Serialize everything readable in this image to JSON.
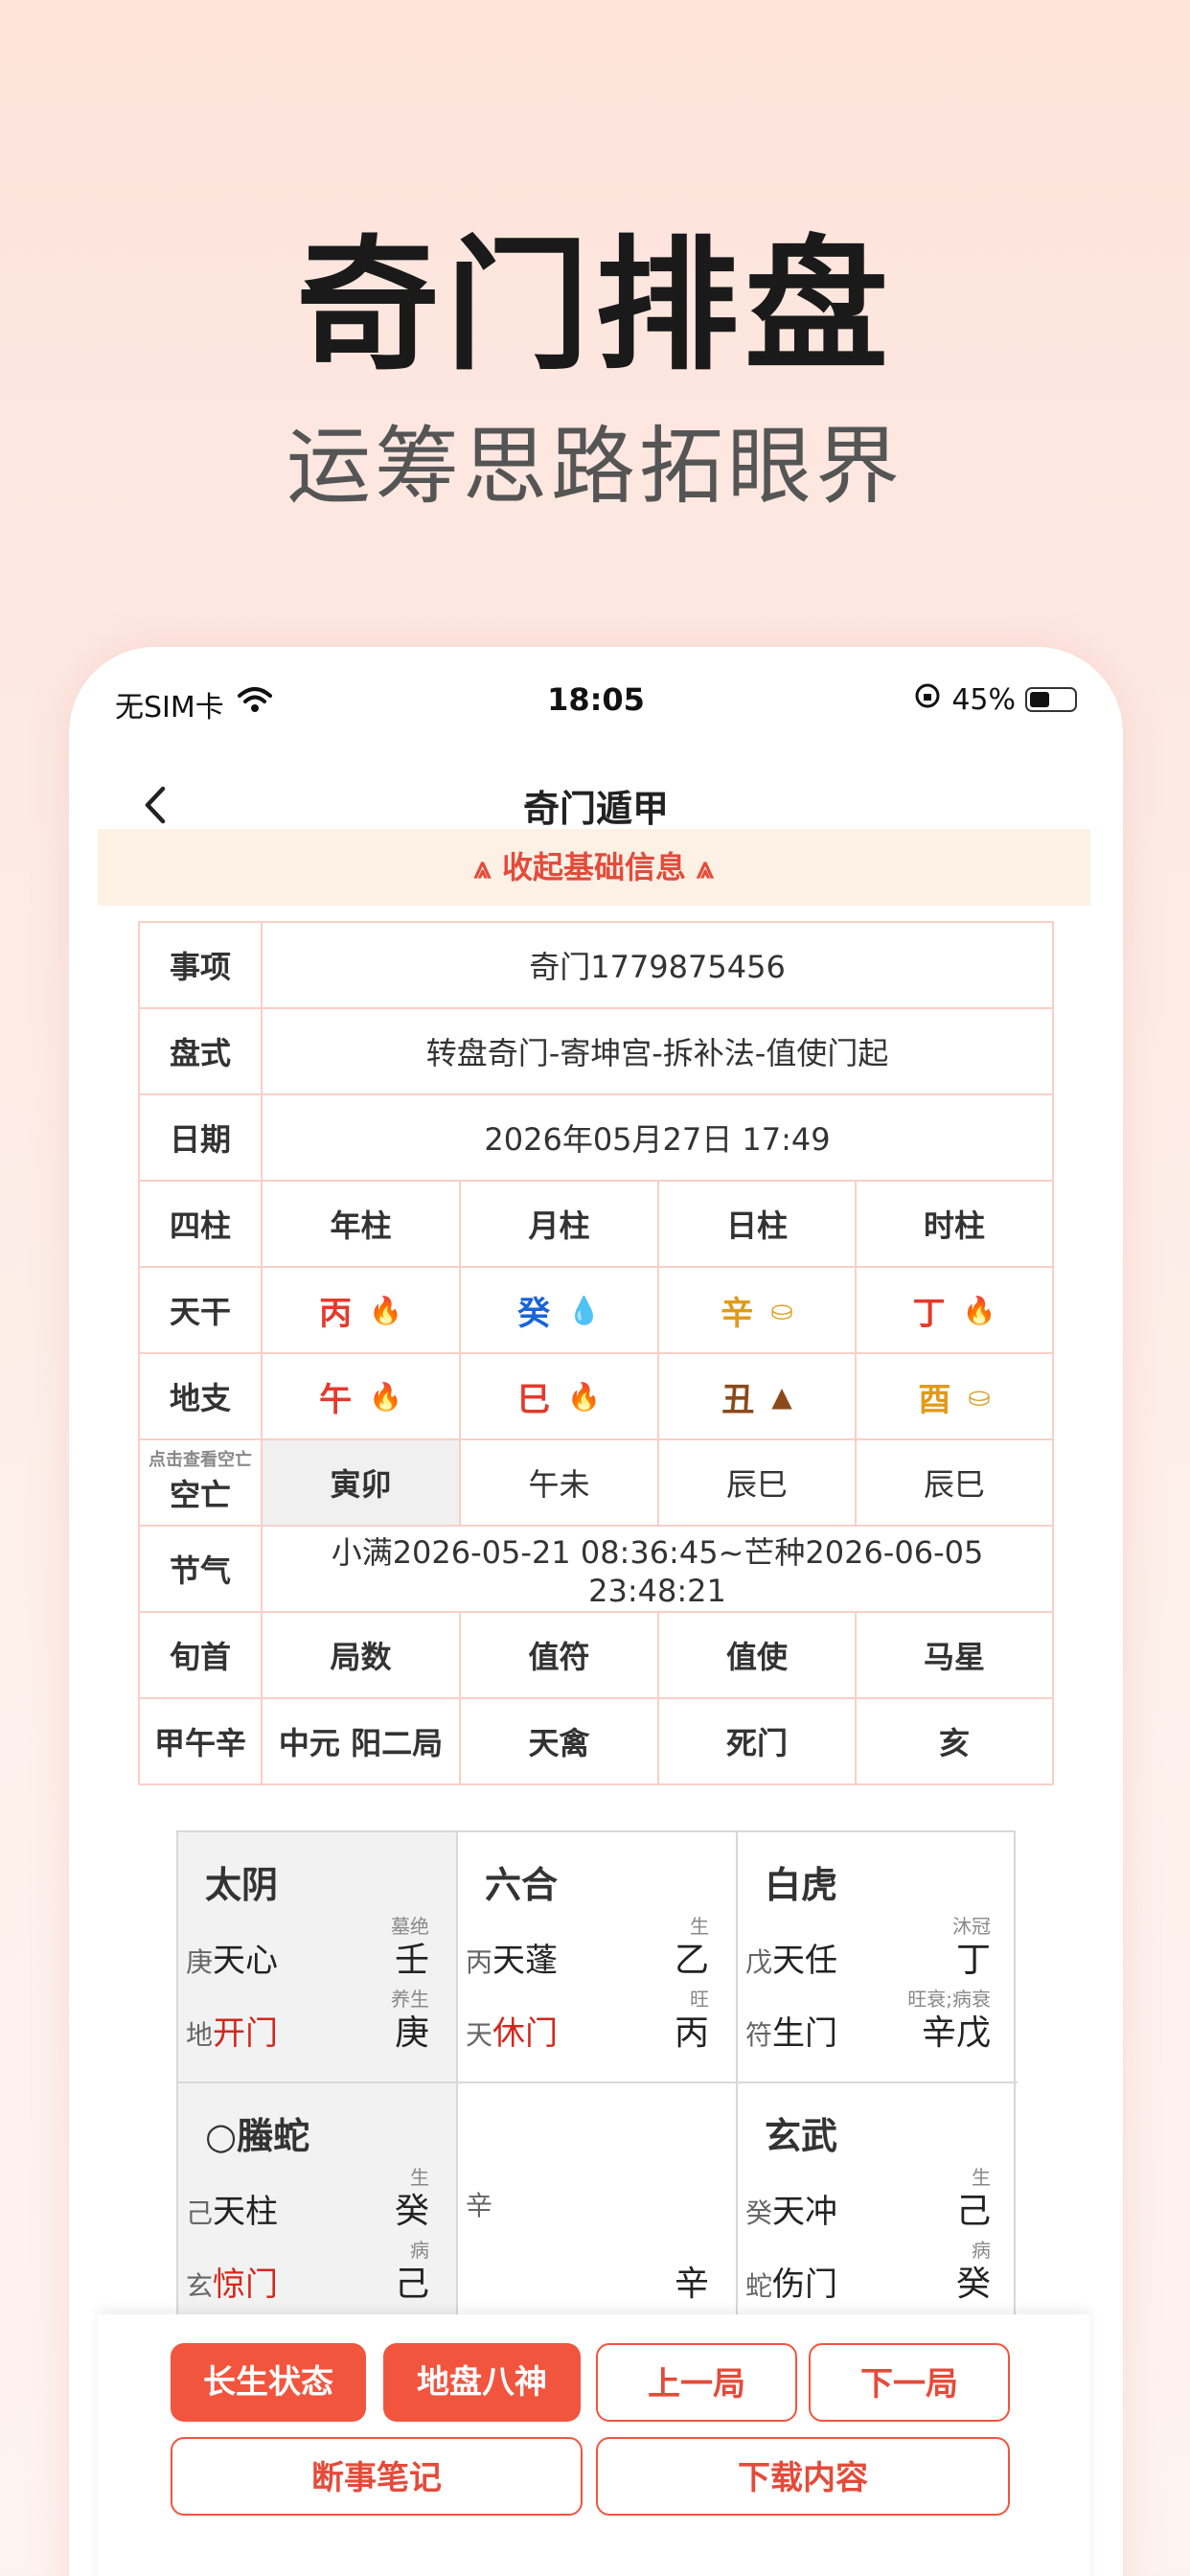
{
  "hero": {
    "title": "奇门排盘",
    "subtitle": "运筹思路拓眼界"
  },
  "status_bar": {
    "carrier": "无SIM卡",
    "time": "18:05",
    "battery": "45%"
  },
  "nav": {
    "title": "奇门遁甲",
    "back_icon": "chevron-left-icon"
  },
  "collapse": {
    "label": "⩓ 收起基础信息 ⩓"
  },
  "info": {
    "shixiang_label": "事项",
    "shixiang_value": "奇门1779875456",
    "panshi_label": "盘式",
    "panshi_value": "转盘奇门-寄坤宫-拆补法-值使门起",
    "date_label": "日期",
    "date_value": "2026年05月27日 17:49",
    "sizhu_label": "四柱",
    "pillars": [
      "年柱",
      "月柱",
      "日柱",
      "时柱"
    ],
    "tiangan_label": "天干",
    "tiangan": [
      "丙",
      "癸",
      "辛",
      "丁"
    ],
    "dizhi_label": "地支",
    "dizhi": [
      "午",
      "巳",
      "丑",
      "酉"
    ],
    "kongwang_hint": "点击查看空亡",
    "kongwang_label": "空亡",
    "kongwang": [
      "寅卯",
      "午未",
      "辰巳",
      "辰巳"
    ],
    "jieqi_label": "节气",
    "jieqi_value": "小满2026-05-21 08:36:45~芒种2026-06-05 23:48:21",
    "headers": [
      "旬首",
      "局数",
      "值符",
      "值使",
      "马星"
    ],
    "values": [
      "甲午辛",
      "中元 阳二局",
      "天禽",
      "死门",
      "亥"
    ]
  },
  "chart": {
    "c1": {
      "god": "太阴",
      "t1": "墓绝",
      "pre1": "庚",
      "star": "天心",
      "v1": "壬",
      "t2": "养生",
      "pre2": "地",
      "door": "开门",
      "v2": "庚"
    },
    "c2": {
      "god": "六合",
      "t1": "生",
      "pre1": "丙",
      "star": "天蓬",
      "v1": "乙",
      "t2": "旺",
      "pre2": "天",
      "door": "休门",
      "v2": "丙"
    },
    "c3": {
      "god": "白虎",
      "t1": "沐冠",
      "pre1": "戊",
      "star": "天任",
      "v1": "丁",
      "t2": "旺衰;病衰",
      "pre2": "符",
      "door": "生门",
      "v2": "辛戊"
    },
    "c4": {
      "god": "○螣蛇",
      "t1": "生",
      "pre1": "己",
      "star": "天柱",
      "v1": "癸",
      "t2": "病",
      "pre2": "玄",
      "door": "惊门",
      "v2": "己"
    },
    "c5": {
      "pre1": "辛",
      "v2": "辛"
    },
    "c6": {
      "god": "玄武",
      "t1": "生",
      "pre1": "癸",
      "star": "天冲",
      "v1": "己",
      "t2": "病",
      "pre2": "蛇",
      "door": "伤门",
      "v2": "癸"
    }
  },
  "buttons": {
    "changsheng": "长生状态",
    "dipan": "地盘八神",
    "prev": "上一局",
    "next": "下一局",
    "notes": "断事笔记",
    "download": "下载内容"
  }
}
